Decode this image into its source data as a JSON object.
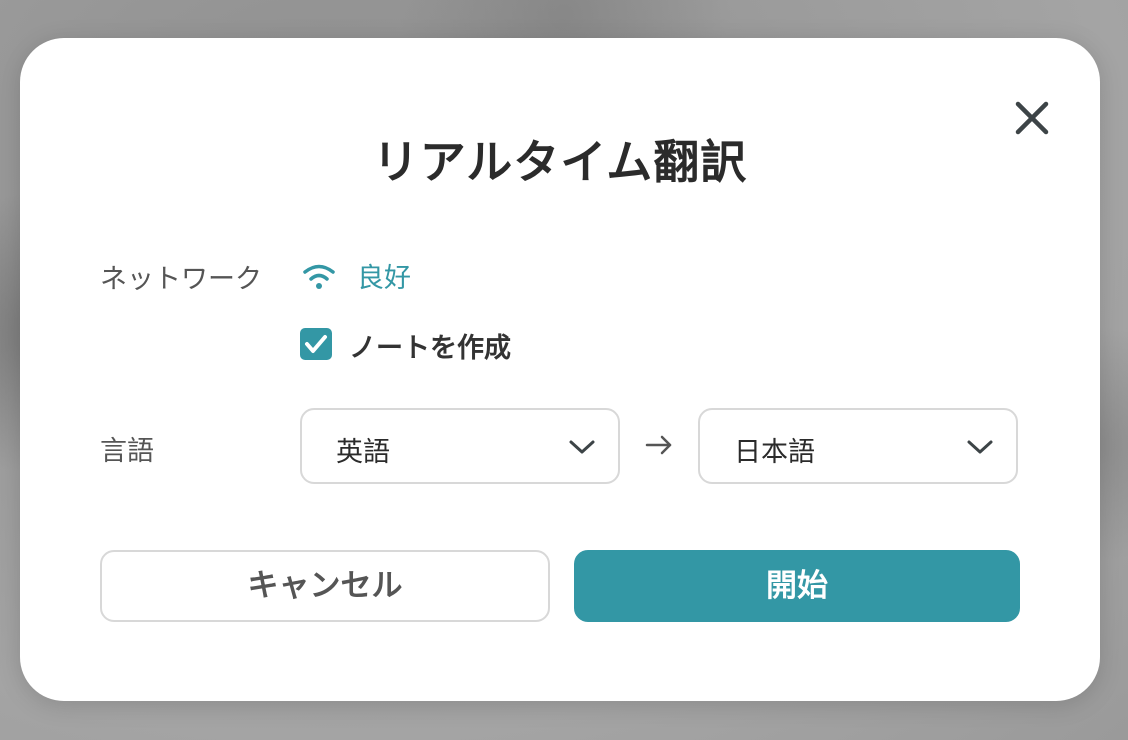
{
  "dialog": {
    "title": "リアルタイム翻訳",
    "close_icon": "close-icon"
  },
  "network": {
    "label": "ネットワーク",
    "icon": "wifi-icon",
    "status": "良好",
    "status_color": "#3397a5"
  },
  "note_option": {
    "label": "ノートを作成",
    "checked": true
  },
  "language": {
    "label": "言語",
    "source": "英語",
    "target": "日本語",
    "arrow_icon": "arrow-right-icon"
  },
  "buttons": {
    "cancel_label": "キャンセル",
    "start_label": "開始"
  },
  "colors": {
    "accent": "#3397a5",
    "title": "#2b2b2b",
    "border": "#d8d8d8"
  }
}
